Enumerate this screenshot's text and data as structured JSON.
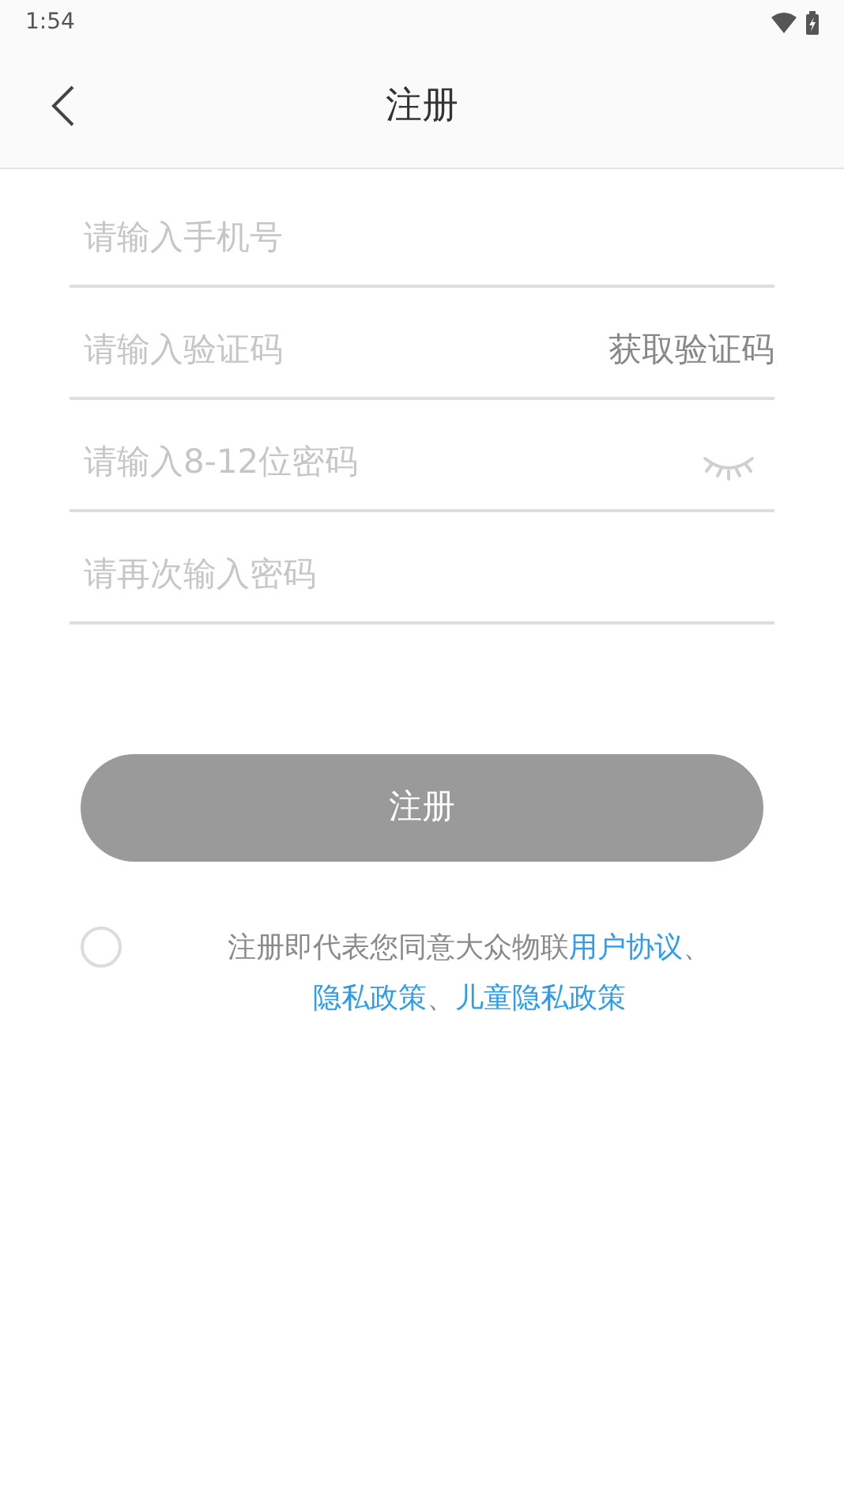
{
  "status_bar": {
    "time": "1:54"
  },
  "header": {
    "title": "注册"
  },
  "fields": [
    {
      "kind": "text",
      "placeholder": "请输入手机号"
    },
    {
      "kind": "code",
      "placeholder": "请输入验证码",
      "action": "获取验证码"
    },
    {
      "kind": "password",
      "placeholder": "请输入8-12位密码",
      "visible": false
    },
    {
      "kind": "text",
      "placeholder": "请再次输入密码"
    }
  ],
  "submit": {
    "label": "注册",
    "disabled": true
  },
  "agreement": {
    "checked": false,
    "parts": [
      {
        "kind": "text",
        "text": "注册即代表您同意大众物联"
      },
      {
        "kind": "link",
        "text": "用户协议"
      },
      {
        "kind": "text",
        "text": "、"
      },
      {
        "kind": "link",
        "text": "隐私政策"
      },
      {
        "kind": "text",
        "text": "、"
      },
      {
        "kind": "link",
        "text": "儿童隐私政策"
      }
    ]
  }
}
